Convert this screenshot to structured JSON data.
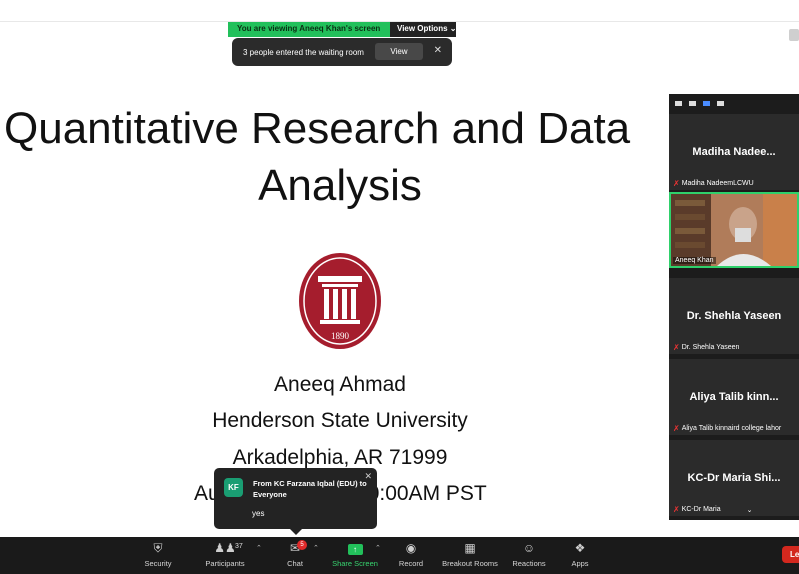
{
  "banner": {
    "viewing": "You are viewing Aneeq Khan's screen",
    "options": "View Options ⌄"
  },
  "waiting": {
    "text": "3 people entered the waiting room",
    "view_label": "View",
    "close": "✕"
  },
  "slide": {
    "title_line1": "Quantitative Research and Data",
    "title_line2": "Analysis",
    "seal_year": "1890",
    "author": "Aneeq Ahmad",
    "university": "Henderson State University",
    "city": "Arkadelphia, AR 71999",
    "date_left": "Au",
    "date_right": "0:00AM PST"
  },
  "chat_popup": {
    "avatar": "KF",
    "from": "From KC Farzana Iqbal (EDU) to Everyone",
    "message": "yes",
    "close": "✕"
  },
  "gallery": {
    "tiles": [
      {
        "name": "Madiha  Nadee...",
        "caption": "Madiha NadeemLCWU"
      },
      {
        "name": "",
        "caption": "Aneeq Khan"
      },
      {
        "name": "Dr. Shehla Yaseen",
        "caption": "Dr. Shehla Yaseen"
      },
      {
        "name": "Aliya  Talib  kinn...",
        "caption": "Aliya Talib kinnaird college lahor"
      },
      {
        "name": "KC-Dr  Maria  Shi...",
        "caption": "KC-Dr Maria"
      }
    ],
    "scroll_chevron": "⌄"
  },
  "toolbar": {
    "security": "Security",
    "participants": "Participants",
    "participants_count": "37",
    "chat": "Chat",
    "chat_badge": "5",
    "share": "Share Screen",
    "record": "Record",
    "breakout": "Breakout Rooms",
    "reactions": "Reactions",
    "apps": "Apps",
    "leave": "Le"
  },
  "colors": {
    "accent_green": "#22c05b",
    "seal_red": "#a51d2d",
    "toolbar_bg": "#1a1a1a"
  }
}
